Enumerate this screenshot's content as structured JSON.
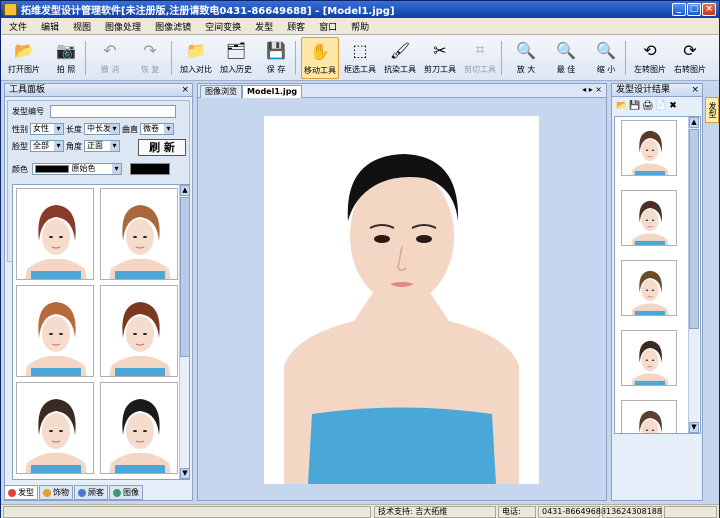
{
  "window": {
    "title": "拓维发型设计管理软件[未注册版,注册请致电0431-86649688] - [Model1.jpg]",
    "min": "_",
    "max": "□",
    "close": "×"
  },
  "menu": [
    "文件",
    "编辑",
    "视图",
    "图像处理",
    "图像滤镜",
    "空间变换",
    "发型",
    "顾客",
    "窗口",
    "帮助"
  ],
  "toolbar": [
    {
      "label": "打开图片",
      "icon": "open-image-icon",
      "glyph": "📂",
      "disabled": false,
      "active": false
    },
    {
      "label": "拍 照",
      "icon": "camera-icon",
      "glyph": "📷",
      "disabled": false,
      "active": false
    },
    {
      "label": "撤 消",
      "icon": "undo-icon",
      "glyph": "↶",
      "disabled": true,
      "active": false
    },
    {
      "label": "恢 复",
      "icon": "redo-icon",
      "glyph": "↷",
      "disabled": true,
      "active": false
    },
    {
      "label": "加入对比",
      "icon": "add-compare-icon",
      "glyph": "📁",
      "disabled": false,
      "active": false
    },
    {
      "label": "加入历史",
      "icon": "add-history-icon",
      "glyph": "🗂",
      "disabled": false,
      "active": false
    },
    {
      "label": "保 存",
      "icon": "save-icon",
      "glyph": "💾",
      "disabled": false,
      "active": false
    },
    {
      "label": "移动工具",
      "icon": "hand-move-icon",
      "glyph": "✋",
      "disabled": false,
      "active": true
    },
    {
      "label": "框选工具",
      "icon": "marquee-select-icon",
      "glyph": "⬚",
      "disabled": false,
      "active": false
    },
    {
      "label": "抗染工具",
      "icon": "brush-icon",
      "glyph": "🖌",
      "disabled": false,
      "active": false
    },
    {
      "label": "剪刀工具",
      "icon": "scissors-icon",
      "glyph": "✂",
      "disabled": false,
      "active": false
    },
    {
      "label": "剪切工具",
      "icon": "crop-icon",
      "glyph": "⌗",
      "disabled": true,
      "active": false
    },
    {
      "label": "放 大",
      "icon": "zoom-in-icon",
      "glyph": "🔍",
      "disabled": false,
      "active": false
    },
    {
      "label": "最 佳",
      "icon": "zoom-fit-icon",
      "glyph": "🔍",
      "disabled": false,
      "active": false
    },
    {
      "label": "缩 小",
      "icon": "zoom-out-icon",
      "glyph": "🔍",
      "disabled": false,
      "active": false
    },
    {
      "label": "左转图片",
      "icon": "rotate-left-icon",
      "glyph": "⟲",
      "disabled": false,
      "active": false
    },
    {
      "label": "右转图片",
      "icon": "rotate-right-icon",
      "glyph": "⟳",
      "disabled": false,
      "active": false
    }
  ],
  "left_panel": {
    "title": "工具面板",
    "close": "×",
    "code_label": "发型编号",
    "code_value": "",
    "gender_label": "性别",
    "gender_value": "女性",
    "length_label": "长度",
    "length_value": "中长发",
    "curl_label": "曲直",
    "curl_value": "微卷",
    "face_label": "脸型",
    "face_value": "全部",
    "angle_label": "角度",
    "angle_value": "正面",
    "refresh_label": "刷 新",
    "color_label": "颜色",
    "color_value": "原始色",
    "color_swatch": "#000000"
  },
  "hair_thumbs": [
    {
      "hair": "#8a3a2a"
    },
    {
      "hair": "#a8683a"
    },
    {
      "hair": "#b86a3a"
    },
    {
      "hair": "#7a3a22"
    },
    {
      "hair": "#3a2a22"
    },
    {
      "hair": "#1a1a1a"
    }
  ],
  "bottom_tabs": [
    {
      "label": "发型",
      "icon": "hair-tab-icon",
      "color": "#d44",
      "active": true
    },
    {
      "label": "饰物",
      "icon": "accessory-tab-icon",
      "color": "#e9a020",
      "active": false
    },
    {
      "label": "顾客",
      "icon": "customer-tab-icon",
      "color": "#4a7ad0",
      "active": false
    },
    {
      "label": "图像",
      "icon": "image-tab-icon",
      "color": "#3a9a6a",
      "active": false
    }
  ],
  "center": {
    "tabs": [
      "图像浏览",
      "Model1.jpg"
    ],
    "active_tab": 1,
    "nav": "◂ ▸ ×"
  },
  "right_panel": {
    "title": "发型设计结果",
    "close": "×",
    "tools": [
      "📂",
      "💾",
      "🖨",
      "📄",
      "✖"
    ],
    "results": [
      {
        "hair": "#5a3a2a"
      },
      {
        "hair": "#4a3022"
      },
      {
        "hair": "#6a4a2a"
      },
      {
        "hair": "#3a2a20"
      },
      {
        "hair": "#5a4030"
      }
    ]
  },
  "side_tab": "发型",
  "status": {
    "support_label": "技术支持: 吉大拓维",
    "phone_label": "电话:",
    "phone1": "0431-86649688",
    "phone2": "13624308188"
  },
  "colors": {
    "titlebar": "#0a3fa8",
    "accent": "#ffe7a8",
    "top_color": "#4aa8d8",
    "skin": "#f3d6c4"
  }
}
